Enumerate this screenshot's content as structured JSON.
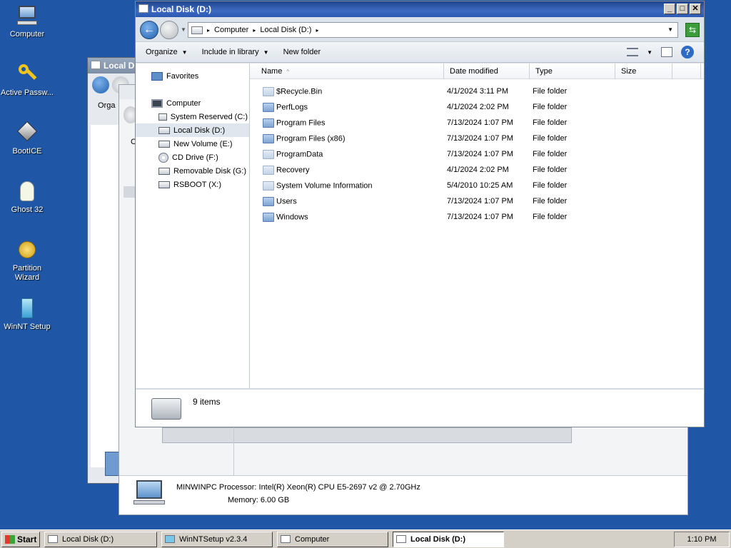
{
  "desktop": {
    "icons": [
      {
        "label": "Computer"
      },
      {
        "label": "Active Passw..."
      },
      {
        "label": "BootICE"
      },
      {
        "label": "Ghost 32"
      },
      {
        "label": "Partition Wizard"
      },
      {
        "label": "WinNT Setup"
      }
    ]
  },
  "back_windows": {
    "win2_title": "Local D",
    "win2_command": "Orga",
    "win3_command": "C",
    "sysinfo": {
      "line1": "MINWINPC Processor: Intel(R) Xeon(R) CPU E5-2697 v2 @ 2.70GHz",
      "line2": "Memory: 6.00 GB"
    }
  },
  "main_window": {
    "title": "Local Disk (D:)",
    "controls": {
      "minimize": "_",
      "maximize": "□",
      "close": "✕"
    },
    "breadcrumb": [
      "Computer",
      "Local Disk (D:)"
    ],
    "command_bar": {
      "organize": "Organize",
      "include_in_library": "Include in library",
      "new_folder": "New folder"
    },
    "nav_pane": {
      "favorites": "Favorites",
      "computer": "Computer",
      "drives": [
        {
          "label": "System Reserved (C:)",
          "icon": "drive-icon"
        },
        {
          "label": "Local Disk (D:)",
          "icon": "drive-icon",
          "selected": true
        },
        {
          "label": "New Volume (E:)",
          "icon": "drive-icon"
        },
        {
          "label": "CD Drive (F:)",
          "icon": "cd-icon"
        },
        {
          "label": "Removable Disk (G:)",
          "icon": "drive-icon"
        },
        {
          "label": "RSBOOT (X:)",
          "icon": "drive-icon"
        }
      ]
    },
    "columns": [
      "Name",
      "Date modified",
      "Type",
      "Size"
    ],
    "files": [
      {
        "name": "$Recycle.Bin",
        "date": "4/1/2024 3:11 PM",
        "type": "File folder",
        "hidden": true
      },
      {
        "name": "PerfLogs",
        "date": "4/1/2024 2:02 PM",
        "type": "File folder"
      },
      {
        "name": "Program Files",
        "date": "7/13/2024 1:07 PM",
        "type": "File folder"
      },
      {
        "name": "Program Files (x86)",
        "date": "7/13/2024 1:07 PM",
        "type": "File folder"
      },
      {
        "name": "ProgramData",
        "date": "7/13/2024 1:07 PM",
        "type": "File folder",
        "hidden": true
      },
      {
        "name": "Recovery",
        "date": "4/1/2024 2:02 PM",
        "type": "File folder",
        "hidden": true
      },
      {
        "name": "System Volume Information",
        "date": "5/4/2010 10:25 AM",
        "type": "File folder",
        "hidden": true
      },
      {
        "name": "Users",
        "date": "7/13/2024 1:07 PM",
        "type": "File folder"
      },
      {
        "name": "Windows",
        "date": "7/13/2024 1:07 PM",
        "type": "File folder"
      }
    ],
    "status": "9 items"
  },
  "taskbar": {
    "start": "Start",
    "tasks": [
      {
        "label": "Local Disk (D:)"
      },
      {
        "label": "WinNTSetup v2.3.4"
      },
      {
        "label": "Computer"
      },
      {
        "label": "Local Disk (D:)",
        "active": true
      }
    ],
    "clock": "1:10 PM"
  }
}
